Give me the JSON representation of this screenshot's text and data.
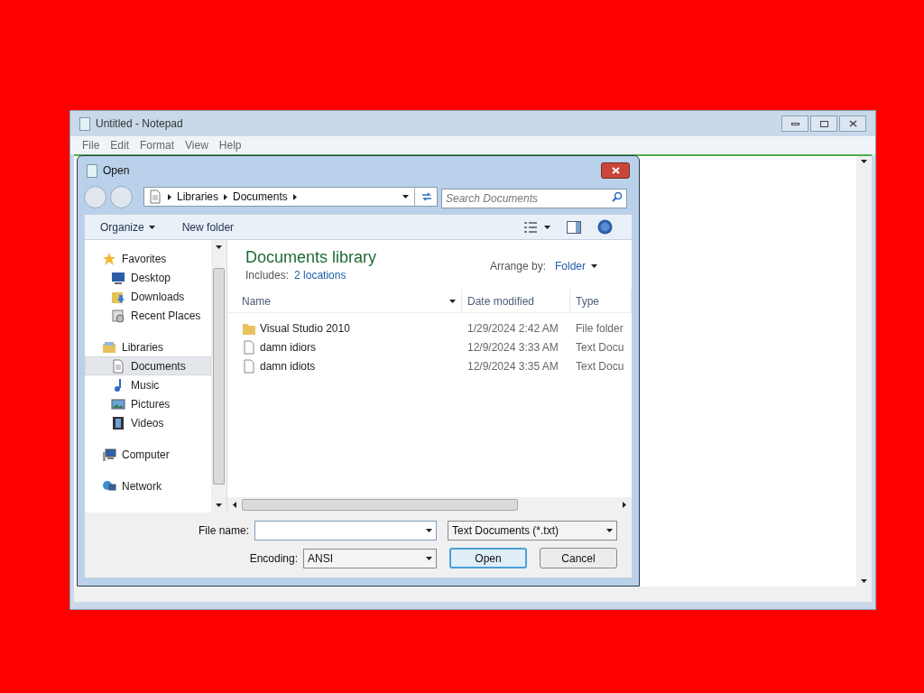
{
  "notepad": {
    "title": "Untitled - Notepad",
    "menu": [
      "File",
      "Edit",
      "Format",
      "View",
      "Help"
    ]
  },
  "dialog": {
    "title": "Open",
    "breadcrumb": [
      "Libraries",
      "Documents"
    ],
    "search": {
      "placeholder": "Search Documents"
    },
    "toolbar": {
      "organize": "Organize",
      "new_folder": "New folder"
    },
    "nav": [
      {
        "label": "Favorites",
        "kind": "star",
        "selected": false,
        "children": [
          {
            "label": "Desktop",
            "kind": "desktop",
            "selected": false
          },
          {
            "label": "Downloads",
            "kind": "download",
            "selected": false
          },
          {
            "label": "Recent Places",
            "kind": "recent",
            "selected": false
          }
        ]
      },
      {
        "label": "Libraries",
        "kind": "library",
        "selected": false,
        "children": [
          {
            "label": "Documents",
            "kind": "document",
            "selected": true
          },
          {
            "label": "Music",
            "kind": "music",
            "selected": false
          },
          {
            "label": "Pictures",
            "kind": "pictures",
            "selected": false
          },
          {
            "label": "Videos",
            "kind": "videos",
            "selected": false
          }
        ]
      },
      {
        "label": "Computer",
        "kind": "computer",
        "selected": false
      },
      {
        "label": "Network",
        "kind": "network",
        "selected": false
      }
    ],
    "library": {
      "title": "Documents library",
      "includes_label": "Includes:",
      "includes_link": "2 locations",
      "arrange_label": "Arrange by:",
      "arrange_value": "Folder"
    },
    "columns": [
      "Name",
      "Date modified",
      "Type"
    ],
    "files": [
      {
        "name": "Visual Studio 2010",
        "date": "1/29/2024 2:42 AM",
        "type": "File folder",
        "kind": "folder"
      },
      {
        "name": "damn idiors",
        "date": "12/9/2024 3:33 AM",
        "type": "Text Docu",
        "kind": "text"
      },
      {
        "name": "damn idiots",
        "date": "12/9/2024 3:35 AM",
        "type": "Text Docu",
        "kind": "text"
      }
    ],
    "file_name": {
      "label": "File name:"
    },
    "filter": "Text Documents (*.txt)",
    "encoding": {
      "label": "Encoding:",
      "value": "ANSI"
    },
    "buttons": [
      {
        "label": "Open",
        "default": true
      },
      {
        "label": "Cancel",
        "default": false
      }
    ]
  }
}
